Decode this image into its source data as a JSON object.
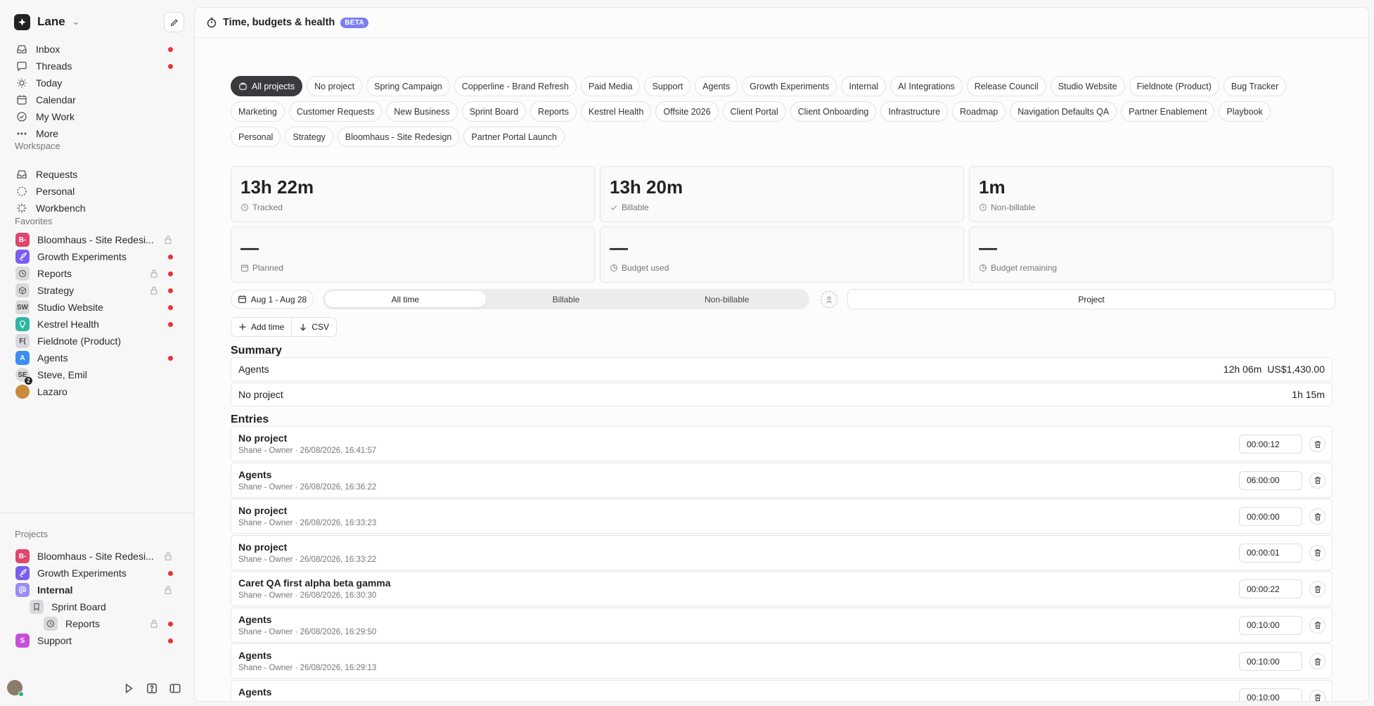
{
  "workspace": {
    "name": "Lane"
  },
  "nav": [
    {
      "label": "Inbox",
      "icon": "inbox-icon",
      "dot": true
    },
    {
      "label": "Threads",
      "icon": "threads-icon",
      "dot": true
    },
    {
      "label": "Today",
      "icon": "sun-icon",
      "dot": false
    },
    {
      "label": "Calendar",
      "icon": "calendar-icon",
      "dot": false
    },
    {
      "label": "My Work",
      "icon": "check-circle-icon",
      "dot": false
    },
    {
      "label": "More",
      "icon": "ellipsis-icon",
      "dot": false
    }
  ],
  "workspace_section": {
    "title": "Workspace",
    "items": [
      {
        "label": "Requests",
        "icon": "inbox-icon"
      },
      {
        "label": "Personal",
        "icon": "dashed-circle-icon"
      },
      {
        "label": "Workbench",
        "icon": "spark-icon"
      }
    ]
  },
  "favorites": {
    "title": "Favorites",
    "items": [
      {
        "label": "Bloomhaus - Site Redesi...",
        "avatar": "B-",
        "color": "#e0456b",
        "lock": true,
        "dot": false
      },
      {
        "label": "Growth Experiments",
        "avatar": "rocket-icon",
        "color": "#7b5cf0",
        "lock": false,
        "dot": true
      },
      {
        "label": "Reports",
        "avatar": "clock-icon",
        "color": "#d9d9dd",
        "lock": true,
        "dot": true
      },
      {
        "label": "Strategy",
        "avatar": "cube-icon",
        "color": "#d9d9dd",
        "lock": true,
        "dot": true
      },
      {
        "label": "Studio Website",
        "avatar": "SW",
        "color": "#d9d9dd",
        "lock": false,
        "dot": true
      },
      {
        "label": "Kestrel Health",
        "avatar": "bulb-icon",
        "color": "#2fb5a3",
        "lock": false,
        "dot": true
      },
      {
        "label": "Fieldnote (Product)",
        "avatar": "F(",
        "color": "#d9d9dd",
        "lock": false,
        "dot": false
      },
      {
        "label": "Agents",
        "avatar": "A",
        "color": "#3d8cf0",
        "lock": false,
        "dot": true
      },
      {
        "label": "Steve, Emil",
        "avatar": "SE",
        "color": "#d9d9dd",
        "lock": false,
        "dot": false,
        "badge": "2"
      },
      {
        "label": "Lazaro",
        "avatar": "photo",
        "color": "#c98a3b",
        "lock": false,
        "dot": false
      }
    ]
  },
  "projects": {
    "title": "Projects",
    "items": [
      {
        "label": "Bloomhaus - Site Redesi...",
        "avatar": "B-",
        "color": "#e0456b",
        "lock": true,
        "dot": false,
        "indent": 0
      },
      {
        "label": "Growth Experiments",
        "avatar": "rocket-icon",
        "color": "#7b5cf0",
        "lock": false,
        "dot": true,
        "indent": 0
      },
      {
        "label": "Internal",
        "avatar": "at-icon",
        "color": "#9b8cf5",
        "lock": true,
        "dot": false,
        "indent": 0,
        "bold": true
      },
      {
        "label": "Sprint Board",
        "avatar": "bookmark-icon",
        "color": "#d9d9dd",
        "lock": false,
        "dot": false,
        "indent": 1
      },
      {
        "label": "Reports",
        "avatar": "clock-icon",
        "color": "#d9d9dd",
        "lock": true,
        "dot": true,
        "indent": 2
      },
      {
        "label": "Support",
        "avatar": "S",
        "color": "#c44fd8",
        "lock": false,
        "dot": true,
        "indent": 0
      }
    ]
  },
  "header": {
    "title": "Time, budgets & health",
    "badge": "BETA"
  },
  "project_filters": [
    "All projects",
    "No project",
    "Spring Campaign",
    "Copperline - Brand Refresh",
    "Paid Media",
    "Support",
    "Agents",
    "Growth Experiments",
    "Internal",
    "AI Integrations",
    "Release Council",
    "Studio Website",
    "Fieldnote (Product)",
    "Bug Tracker",
    "Marketing",
    "Customer Requests",
    "New Business",
    "Sprint Board",
    "Reports",
    "Kestrel Health",
    "Offsite 2026",
    "Client Portal",
    "Client Onboarding",
    "Infrastructure",
    "Roadmap",
    "Navigation Defaults QA",
    "Partner Enablement",
    "Playbook",
    "Personal",
    "Strategy",
    "Bloomhaus - Site Redesign",
    "Partner Portal Launch"
  ],
  "active_filter": "All projects",
  "stats": [
    {
      "value": "13h 22m",
      "label": "Tracked",
      "icon": "clock-icon"
    },
    {
      "value": "13h 20m",
      "label": "Billable",
      "icon": "check-icon"
    },
    {
      "value": "1m",
      "label": "Non-billable",
      "icon": "clock-icon"
    },
    {
      "value": "—",
      "label": "Planned",
      "icon": "calendar-icon"
    },
    {
      "value": "—",
      "label": "Budget used",
      "icon": "pie-icon"
    },
    {
      "value": "—",
      "label": "Budget remaining",
      "icon": "pie-icon"
    }
  ],
  "filters": {
    "date_range": "Aug 1 - Aug 28",
    "billing_options": [
      "All time",
      "Billable",
      "Non-billable"
    ],
    "billing_selected": "All time",
    "group_by": "Project"
  },
  "actions": {
    "add_time": "Add time",
    "csv": "CSV"
  },
  "summary": {
    "title": "Summary",
    "rows": [
      {
        "name": "Agents",
        "duration": "12h 06m",
        "amount": "US$1,430.00"
      },
      {
        "name": "No project",
        "duration": "1h 15m",
        "amount": ""
      }
    ]
  },
  "entries": {
    "title": "Entries",
    "rows": [
      {
        "title": "No project",
        "meta": "Shane - Owner · 26/08/2026, 16:41:57",
        "duration": "00:00:12"
      },
      {
        "title": "Agents",
        "meta": "Shane - Owner · 26/08/2026, 16:36:22",
        "duration": "06:00:00"
      },
      {
        "title": "No project",
        "meta": "Shane - Owner · 26/08/2026, 16:33:23",
        "duration": "00:00:00"
      },
      {
        "title": "No project",
        "meta": "Shane - Owner · 26/08/2026, 16:33:22",
        "duration": "00:00:01"
      },
      {
        "title": "Caret QA first alpha beta gamma",
        "meta": "Shane - Owner · 26/08/2026, 16:30:30",
        "duration": "00:00:22"
      },
      {
        "title": "Agents",
        "meta": "Shane - Owner · 26/08/2026, 16:29:50",
        "duration": "00:10:00"
      },
      {
        "title": "Agents",
        "meta": "Shane - Owner · 26/08/2026, 16:29:13",
        "duration": "00:10:00"
      },
      {
        "title": "Agents",
        "meta": "",
        "duration": "00:10:00"
      }
    ]
  }
}
